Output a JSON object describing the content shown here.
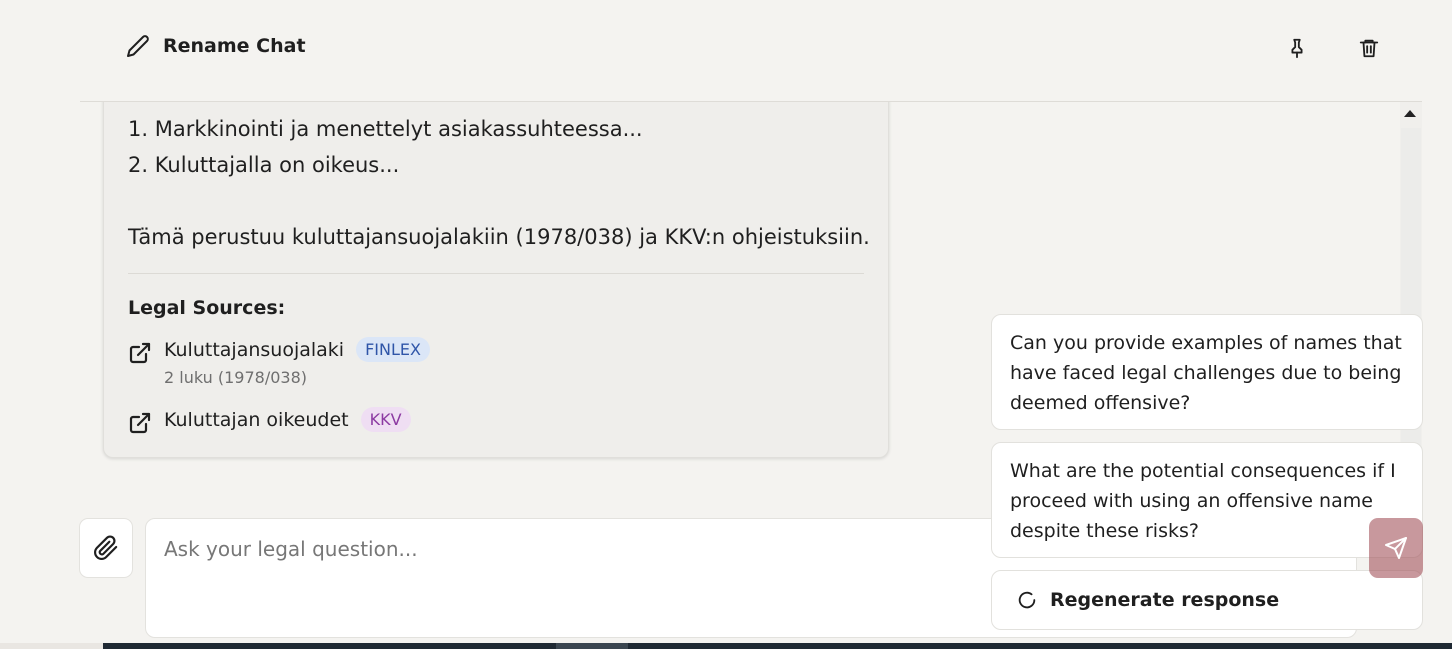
{
  "header": {
    "rename_label": "Rename Chat",
    "icons": [
      "pencil-icon",
      "pin-icon",
      "trash-icon"
    ]
  },
  "answer": {
    "list_items": [
      "1. Markkinointi ja menettelyt asiakassuhteessa...",
      "2. Kuluttajalla on oikeus..."
    ],
    "basis_text": "Tämä perustuu kuluttajansuojalakiin (1978/038) ja KKV:n ohjeistuksiin.",
    "sources_heading": "Legal Sources:",
    "sources": [
      {
        "name": "Kuluttajansuojalaki",
        "badge": "FINLEX",
        "detail": "2 luku (1978/038)",
        "badge_color": "#2f55a8"
      },
      {
        "name": "Kuluttajan oikeudet",
        "badge": "KKV",
        "badge_color": "#8c3aa2"
      }
    ]
  },
  "composer": {
    "placeholder": "Ask your legal question...",
    "value": ""
  },
  "suggestions": [
    "Can you provide examples of names that have faced legal challenges due to being deemed offensive?",
    "What are the potential consequences if I proceed with using an offensive name despite these risks?"
  ],
  "regenerate_label": "Regenerate response",
  "colors": {
    "background": "#f4f3f0",
    "send_button": "#c99ba0",
    "finlex_badge_bg": "#dbe6f7",
    "kkv_badge_bg": "#efdef3"
  }
}
